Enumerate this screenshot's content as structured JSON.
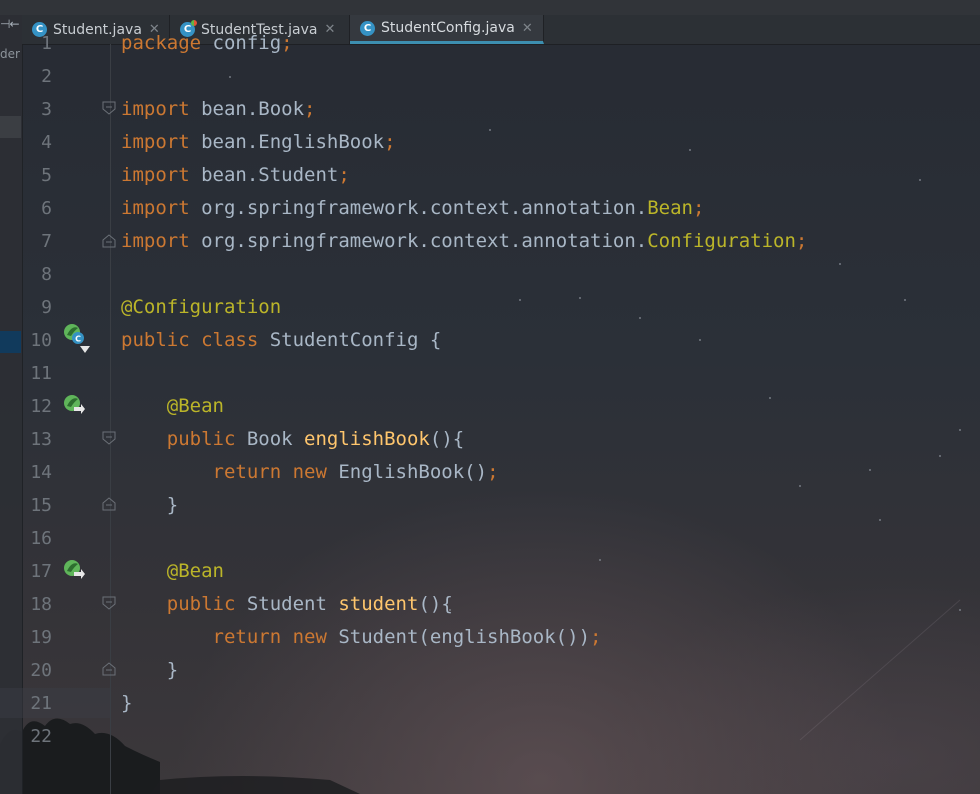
{
  "tabs": [
    {
      "label": "Student.java",
      "icon": "java-class-icon",
      "active": false
    },
    {
      "label": "StudentTest.java",
      "icon": "java-test-class-icon",
      "active": false
    },
    {
      "label": "StudentConfig.java",
      "icon": "java-class-icon",
      "active": true
    }
  ],
  "left_panel": {
    "fragment_top": "⊣←",
    "fragment_text": "der"
  },
  "colors": {
    "keyword": "#cc7832",
    "annotation": "#bbb529",
    "method": "#ffc66d",
    "plain": "#a9b7c6",
    "line_number": "#6e747b",
    "active_tab_underline": "#3d8fb0"
  },
  "editor": {
    "line_numbers": [
      "1",
      "2",
      "3",
      "4",
      "5",
      "6",
      "7",
      "8",
      "9",
      "10",
      "11",
      "12",
      "13",
      "14",
      "15",
      "16",
      "17",
      "18",
      "19",
      "20",
      "21",
      "22"
    ],
    "lines": [
      {
        "indent": "",
        "tokens": [
          {
            "t": "package",
            "c": "kw"
          },
          {
            "t": " config",
            "c": "pl"
          },
          {
            "t": ";",
            "c": "kw"
          }
        ]
      },
      {
        "indent": "",
        "tokens": []
      },
      {
        "indent": "",
        "tokens": [
          {
            "t": "import",
            "c": "kw"
          },
          {
            "t": " bean.Book",
            "c": "pl"
          },
          {
            "t": ";",
            "c": "kw"
          }
        ]
      },
      {
        "indent": "",
        "tokens": [
          {
            "t": "import",
            "c": "kw"
          },
          {
            "t": " bean.EnglishBook",
            "c": "pl"
          },
          {
            "t": ";",
            "c": "kw"
          }
        ]
      },
      {
        "indent": "",
        "tokens": [
          {
            "t": "import",
            "c": "kw"
          },
          {
            "t": " bean.Student",
            "c": "pl"
          },
          {
            "t": ";",
            "c": "kw"
          }
        ]
      },
      {
        "indent": "",
        "tokens": [
          {
            "t": "import",
            "c": "kw"
          },
          {
            "t": " org.springframework.context.annotation.",
            "c": "pl"
          },
          {
            "t": "Bean",
            "c": "ann"
          },
          {
            "t": ";",
            "c": "kw"
          }
        ]
      },
      {
        "indent": "",
        "tokens": [
          {
            "t": "import",
            "c": "kw"
          },
          {
            "t": " org.springframework.context.annotation.",
            "c": "pl"
          },
          {
            "t": "Configuration",
            "c": "ann"
          },
          {
            "t": ";",
            "c": "kw"
          }
        ]
      },
      {
        "indent": "",
        "tokens": []
      },
      {
        "indent": "",
        "tokens": [
          {
            "t": "@Configuration",
            "c": "ann"
          }
        ]
      },
      {
        "indent": "",
        "tokens": [
          {
            "t": "public class",
            "c": "kw"
          },
          {
            "t": " StudentConfig {",
            "c": "pl"
          }
        ]
      },
      {
        "indent": "",
        "tokens": []
      },
      {
        "indent": "    ",
        "tokens": [
          {
            "t": "@Bean",
            "c": "ann"
          }
        ]
      },
      {
        "indent": "    ",
        "tokens": [
          {
            "t": "public",
            "c": "kw"
          },
          {
            "t": " Book ",
            "c": "pl"
          },
          {
            "t": "englishBook",
            "c": "fn"
          },
          {
            "t": "(){",
            "c": "pl"
          }
        ]
      },
      {
        "indent": "        ",
        "tokens": [
          {
            "t": "return new",
            "c": "kw"
          },
          {
            "t": " EnglishBook()",
            "c": "pl"
          },
          {
            "t": ";",
            "c": "kw"
          }
        ]
      },
      {
        "indent": "    ",
        "tokens": [
          {
            "t": "}",
            "c": "pl"
          }
        ]
      },
      {
        "indent": "",
        "tokens": []
      },
      {
        "indent": "    ",
        "tokens": [
          {
            "t": "@Bean",
            "c": "ann"
          }
        ]
      },
      {
        "indent": "    ",
        "tokens": [
          {
            "t": "public",
            "c": "kw"
          },
          {
            "t": " Student ",
            "c": "pl"
          },
          {
            "t": "student",
            "c": "fn"
          },
          {
            "t": "(){",
            "c": "pl"
          }
        ]
      },
      {
        "indent": "        ",
        "tokens": [
          {
            "t": "return new",
            "c": "kw"
          },
          {
            "t": " Student(englishBook())",
            "c": "pl"
          },
          {
            "t": ";",
            "c": "kw"
          }
        ]
      },
      {
        "indent": "    ",
        "tokens": [
          {
            "t": "}",
            "c": "pl"
          }
        ]
      },
      {
        "indent": "",
        "tokens": [
          {
            "t": "}",
            "c": "pl"
          }
        ]
      },
      {
        "indent": "",
        "tokens": []
      }
    ]
  },
  "gutter_icons": {
    "config_class_icon": "spring-config-icon",
    "bean_icon": "spring-bean-navigate-icon",
    "class_badge": "C"
  }
}
